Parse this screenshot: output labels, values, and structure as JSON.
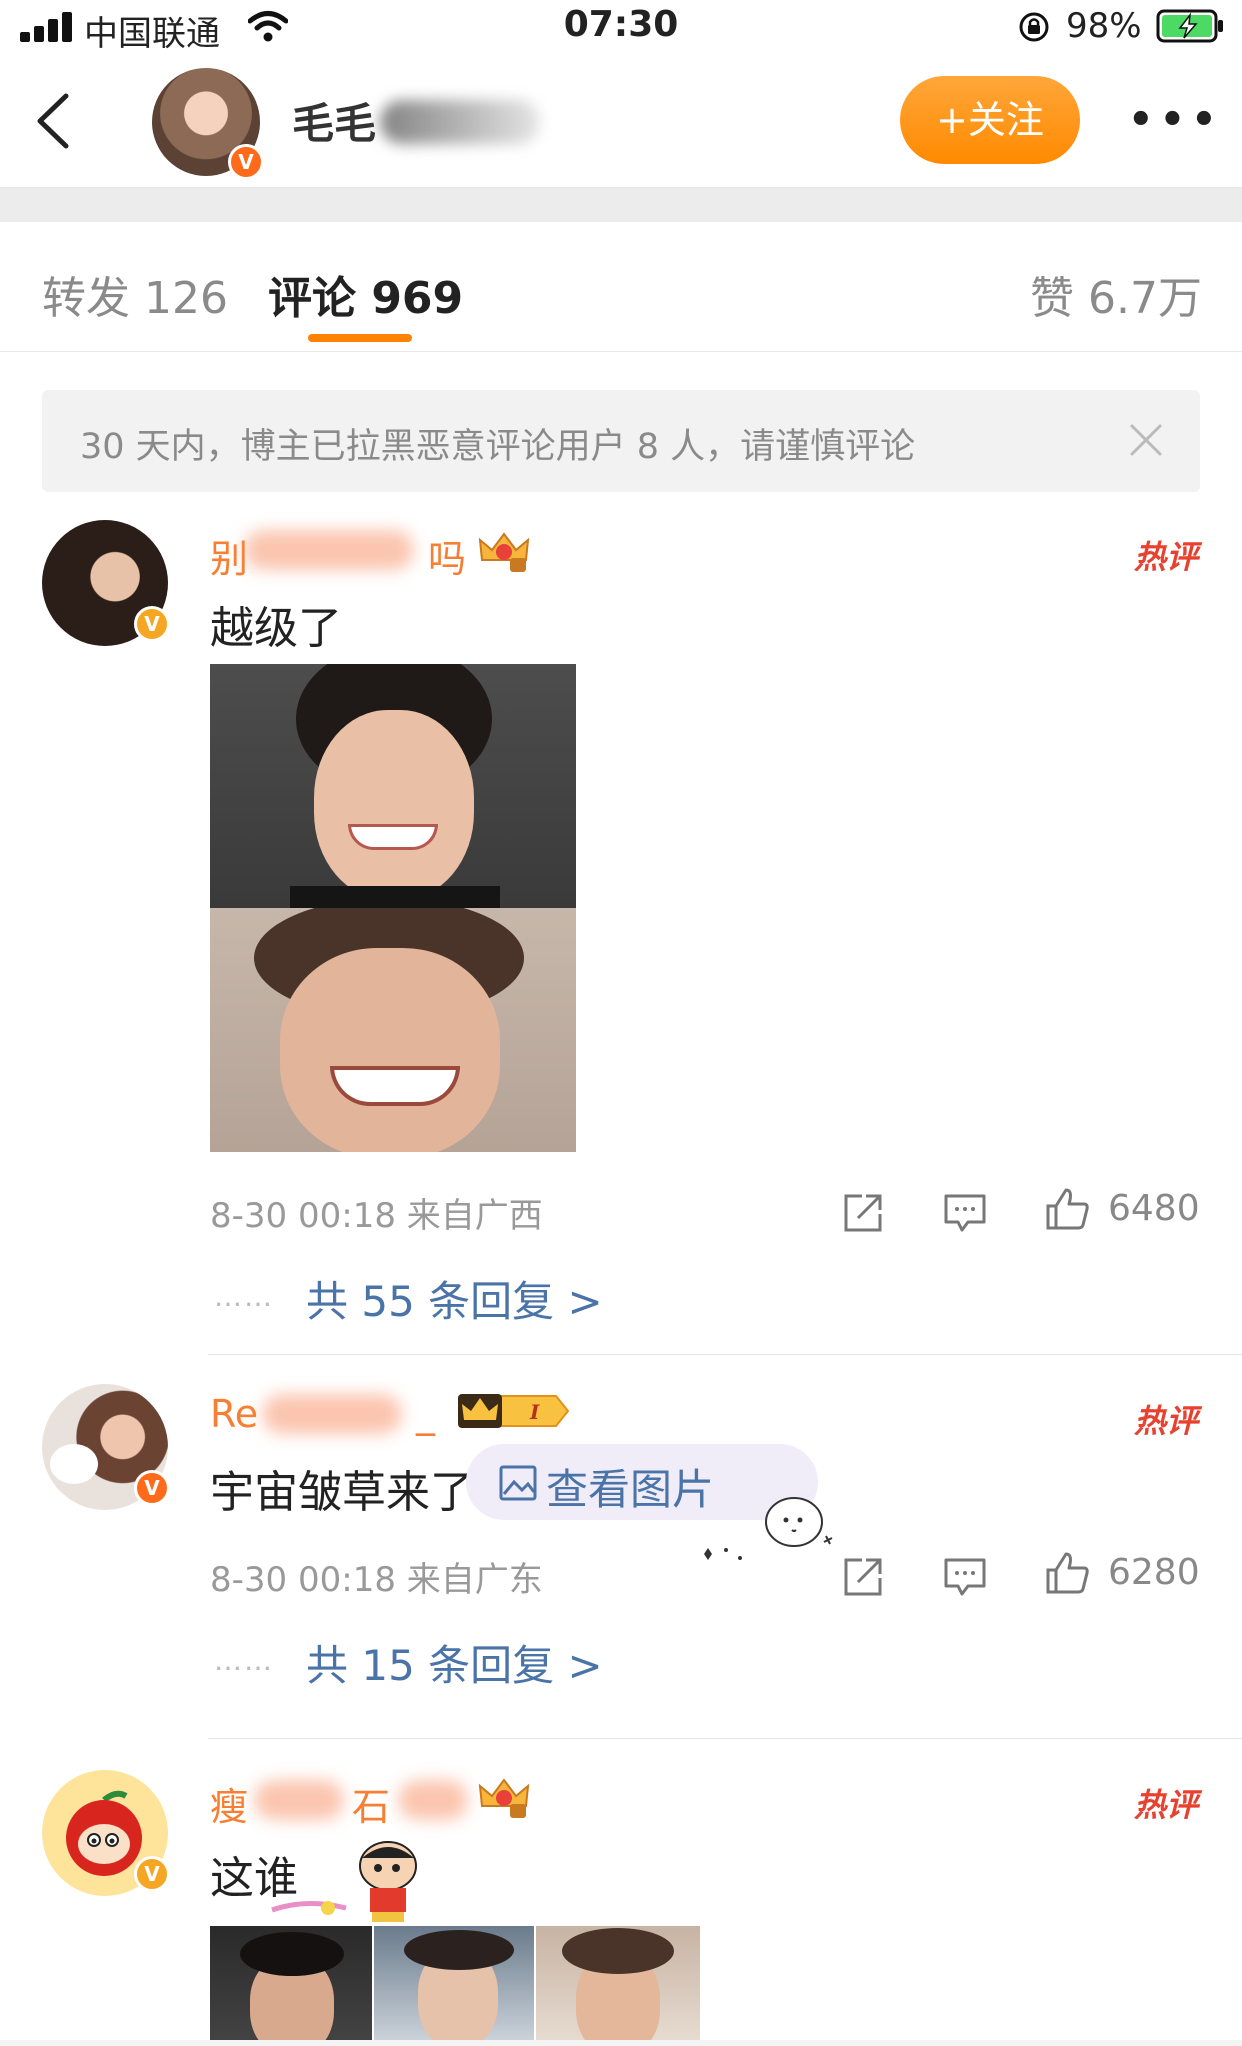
{
  "status_bar": {
    "carrier": "中国联通",
    "time": "07:30",
    "battery_percent": "98%"
  },
  "header": {
    "name_visible": "毛毛",
    "follow_label": "+关注",
    "more_icon": "more-icon"
  },
  "tabs": {
    "repost": "转发 126",
    "comment": "评论 969",
    "like": "赞 6.7万"
  },
  "notice": {
    "text": "30 天内，博主已拉黑恶意评论用户 8 人，请谨慎评论"
  },
  "comments": [
    {
      "name_visible": "别",
      "name_end": "吗",
      "text": "越级了",
      "hot_label": "热评",
      "meta": "8-30 00:18 来自广西",
      "likes": "6480",
      "reply_dots": "……",
      "replies": "共 55 条回复 >"
    },
    {
      "name_visible": "Re",
      "name_end": "_",
      "text": "宇宙皱草来了",
      "view_pic": "查看图片",
      "hot_label": "热评",
      "meta": "8-30 00:18 来自广东",
      "likes": "6280",
      "reply_dots": "……",
      "replies": "共 15 条回复 >"
    },
    {
      "name_visible": "瘦",
      "name_end": "石",
      "text": "这谁",
      "hot_label": "热评"
    }
  ],
  "colors": {
    "accent": "#ff8200",
    "name": "#f77f33",
    "link": "#4a73a8",
    "hot": "#e8412f"
  }
}
